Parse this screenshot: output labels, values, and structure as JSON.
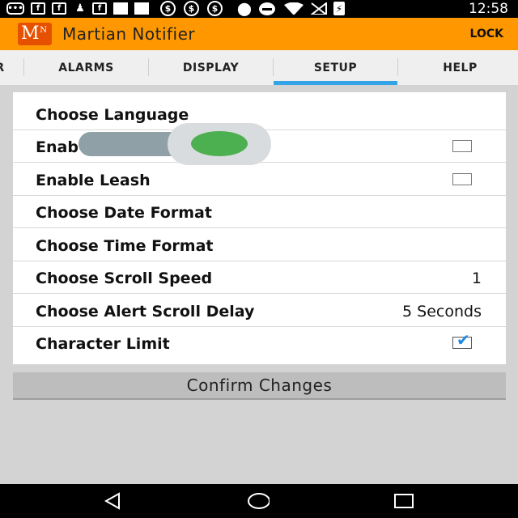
{
  "status_bar": {
    "icons": [
      "message-icon",
      "facebook-icon",
      "facebook-icon",
      "notification-icon",
      "facebook-icon",
      "image-icon",
      "image-icon",
      "money-icon",
      "money-icon",
      "money-icon",
      "location-icon",
      "dnd-icon",
      "wifi-icon",
      "no-signal-icon",
      "battery-charging-icon"
    ],
    "time": "12:58"
  },
  "app_bar": {
    "logo_letter": "M",
    "logo_superscript": "N",
    "title": "Martian Notifier",
    "action_label": "LOCK"
  },
  "tabs": {
    "items": [
      {
        "label": "R",
        "active": false
      },
      {
        "label": "ALARMS",
        "active": false
      },
      {
        "label": "DISPLAY",
        "active": false
      },
      {
        "label": "SETUP",
        "active": true
      },
      {
        "label": "HELP",
        "active": false
      }
    ],
    "indicator_color": "#33a4e6"
  },
  "settings": {
    "rows": [
      {
        "label": "Choose Language"
      },
      {
        "label": "Enab",
        "checked": false,
        "toggle_on": true
      },
      {
        "label": "Enable Leash",
        "checked": false
      },
      {
        "label": "Choose Date Format"
      },
      {
        "label": "Choose Time Format"
      },
      {
        "label": "Choose Scroll Speed",
        "value": "1"
      },
      {
        "label": "Choose Alert Scroll Delay",
        "value": "5 Seconds"
      },
      {
        "label": "Character Limit",
        "checked": true
      }
    ]
  },
  "confirm_button": {
    "label": "Confirm Changes"
  },
  "nav_bar": {
    "icons": [
      "back-icon",
      "home-icon",
      "recents-icon"
    ]
  },
  "colors": {
    "app_bar": "#ff9800",
    "toggle_on": "#4caf50",
    "checkmark": "#1e88e5"
  }
}
